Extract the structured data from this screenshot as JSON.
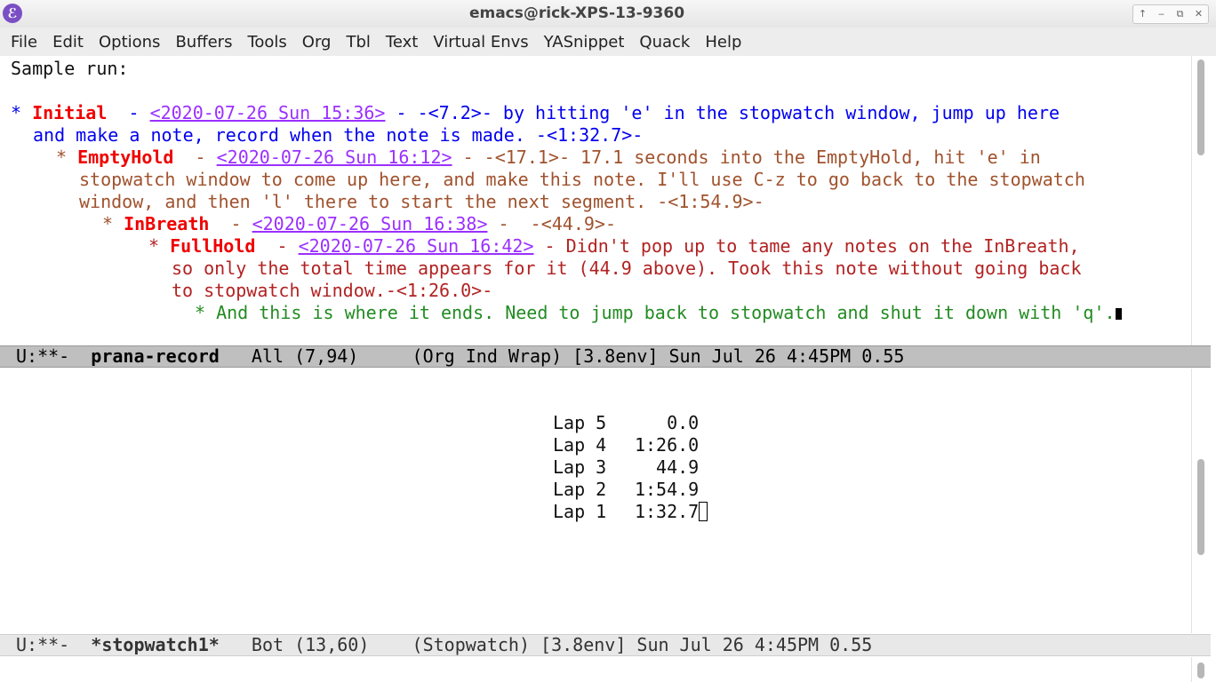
{
  "window": {
    "title": "emacs@rick-XPS-13-9360",
    "icon": "emacs-icon",
    "controls": [
      "↑",
      "‒",
      "⧉",
      "✕"
    ]
  },
  "menu": [
    "File",
    "Edit",
    "Options",
    "Buffers",
    "Tools",
    "Org",
    "Tbl",
    "Text",
    "Virtual Envs",
    "YASnippet",
    "Quack",
    "Help"
  ],
  "top_buffer": {
    "line0": "Sample run:",
    "line1": {
      "star": "* ",
      "heading": "Initial",
      "sep": "  - ",
      "timestamp": "<2020-07-26 Sun 15:36>",
      "text": " - -<7.2>- by hitting 'e' in the stopwatch window, jump up here"
    },
    "line2": "and make a note, record when the note is made. -<1:32.7>-",
    "line3": {
      "star": "* ",
      "heading": "EmptyHold",
      "sep": "  - ",
      "timestamp": "<2020-07-26 Sun 16:12>",
      "text": " - -<17.1>- 17.1 seconds into the EmptyHold, hit 'e' in"
    },
    "line4": "stopwatch window to come up here, and make this note. I'll use C-z to go back to the stopwatch",
    "line5": "window, and then 'l' there to start the next segment. -<1:54.9>-",
    "line6": {
      "star": "* ",
      "heading": "InBreath",
      "sep": "  - ",
      "timestamp": "<2020-07-26 Sun 16:38>",
      "text": " -  -<44.9>-"
    },
    "line7": {
      "star": "* ",
      "heading": "FullHold",
      "sep": "  - ",
      "timestamp": "<2020-07-26 Sun 16:42>",
      "text": " - Didn't pop up to tame any notes on the InBreath,"
    },
    "line8": "so only the total time appears for it (44.9 above). Took this note without going back",
    "line9": "to stopwatch window.-<1:26.0>-",
    "line10": "* And this is where it ends. Need to jump back to stopwatch and shut it down with 'q'."
  },
  "modeline_top": {
    "status": "U:**-  ",
    "buffer": "prana-record",
    "rest": "   All (7,94)     (Org Ind Wrap) [3.8env] Sun Jul 26 4:45PM 0.55"
  },
  "laps": [
    {
      "label": "Lap 5",
      "time": "0.0"
    },
    {
      "label": "Lap 4",
      "time": "1:26.0"
    },
    {
      "label": "Lap 3",
      "time": "44.9"
    },
    {
      "label": "Lap 2",
      "time": "1:54.9"
    },
    {
      "label": "Lap 1",
      "time": "1:32.7"
    }
  ],
  "modeline_bottom": {
    "status": "U:**-  ",
    "buffer": "*stopwatch1*",
    "rest": "   Bot (13,60)    (Stopwatch) [3.8env] Sun Jul 26 4:45PM 0.55"
  },
  "colors": {
    "heading_keyword": "#f00000",
    "level1": "#0000ee",
    "level2": "#a0522d",
    "level4": "#b22222",
    "level5": "#228b22",
    "timestamp": "#9b30ff",
    "modeline": "#bfbfbf"
  }
}
